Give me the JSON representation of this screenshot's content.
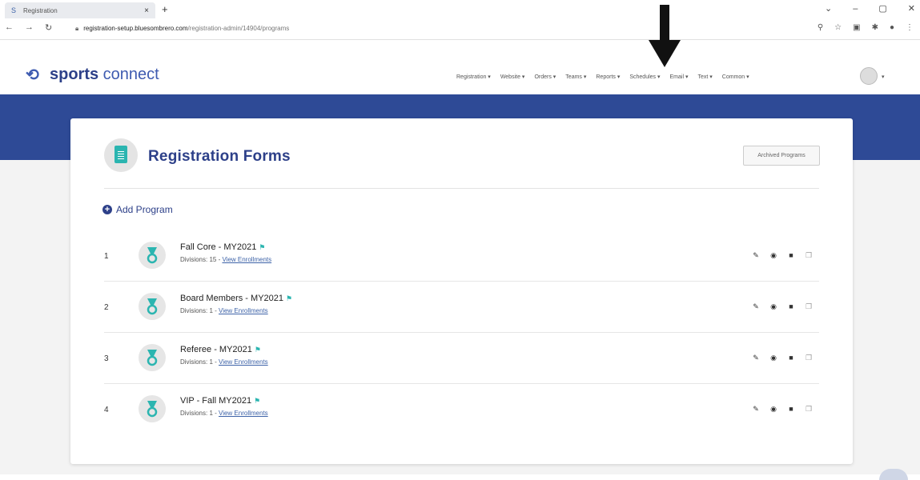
{
  "browser": {
    "tab_title": "Registration",
    "tab_close": "×",
    "new_tab": "+",
    "url_host": "registration-setup.bluesombrero.com",
    "url_path": "/registration-admin/14904/programs"
  },
  "header": {
    "brand_bold": "sports",
    "brand_rest": " connect",
    "nav": [
      "Registration ▾",
      "Website ▾",
      "Orders ▾",
      "Teams ▾",
      "Reports ▾",
      "Schedules ▾",
      "Email ▾",
      "Text ▾",
      "Common ▾"
    ]
  },
  "page": {
    "title": "Registration Forms",
    "archived_button": "Archived Programs",
    "add_program": "Add Program"
  },
  "programs": [
    {
      "num": "1",
      "name": "Fall Core - MY2021",
      "divisions": "Divisions: 15 - ",
      "link": "View Enrollments"
    },
    {
      "num": "2",
      "name": "Board Members - MY2021",
      "divisions": "Divisions: 1 - ",
      "link": "View Enrollments"
    },
    {
      "num": "3",
      "name": "Referee - MY2021",
      "divisions": "Divisions: 1 - ",
      "link": "View Enrollments"
    },
    {
      "num": "4",
      "name": "VIP - Fall MY2021",
      "divisions": "Divisions: 1 - ",
      "link": "View Enrollments"
    }
  ],
  "colors": {
    "brand_blue": "#2d4089",
    "band_blue": "#2e4a96",
    "teal": "#2bb5b0"
  }
}
